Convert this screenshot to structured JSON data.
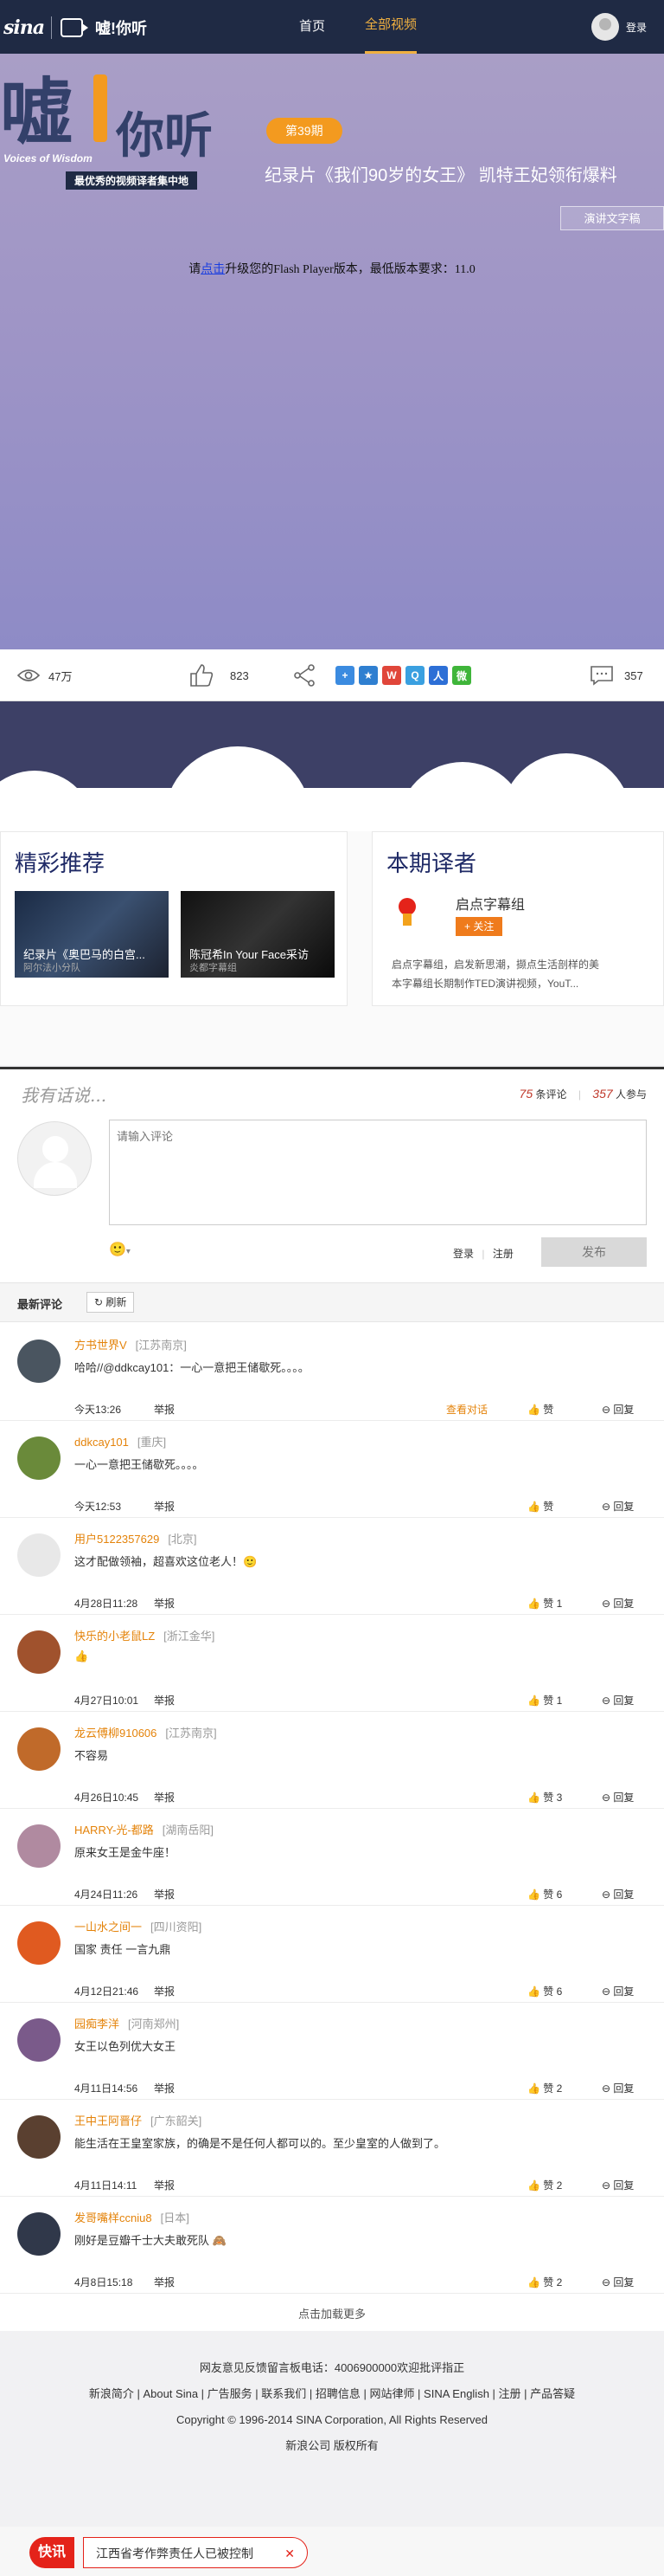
{
  "nav": {
    "logo_text": "sina",
    "subtitle": "嘘!你听",
    "links": [
      "首页",
      "全部视频"
    ],
    "login": "登录"
  },
  "hero": {
    "brand_big": "嘘",
    "brand_ting": "你听",
    "brand_en": "Voices of Wisdom",
    "brand_tagline": "最优秀的视频译者集中地",
    "issue": "第39期",
    "title": "纪录片《我们90岁的女王》 凯特王妃领衔爆料",
    "transcript_button": "演讲文字稿",
    "flash_before": "请",
    "flash_link": "点击",
    "flash_after": "升级您的Flash Player版本，最低版本要求：11.0"
  },
  "actions": {
    "views": "47万",
    "likes": "823",
    "comments": "357"
  },
  "recommend": {
    "heading": "精彩推荐",
    "items": [
      {
        "caption": "纪录片《奥巴马的白宫...",
        "sub": "阿尔法小分队"
      },
      {
        "caption": "陈冠希In Your Face采访",
        "sub": "炎都字幕组"
      }
    ]
  },
  "translator": {
    "heading": "本期译者",
    "name": "启点字幕组",
    "follow": "+ 关注",
    "desc_line1": "启点字幕组，启发新思潮，撷点生活剖样的美",
    "desc_line2": "本字幕组长期制作TED演讲视频，YouT..."
  },
  "comment_box": {
    "title": "我有话说...",
    "count_comments": "75",
    "count_comments_label": "条评论",
    "count_people": "357",
    "count_people_label": "人参与",
    "placeholder": "请输入评论",
    "login": "登录",
    "register": "注册",
    "publish": "发布",
    "latest": "最新评论",
    "refresh": "刷新"
  },
  "comments": [
    {
      "name": "方书世界V",
      "loc": "[江苏南京]",
      "text": "哈哈//@ddkcay101：一心一意把王储歇死。。。。",
      "time": "今天13:26",
      "like": "赞",
      "conversation": "查看对话",
      "avatar_color": "#4a5560"
    },
    {
      "name": "ddkcay101",
      "loc": "[重庆]",
      "text": "一心一意把王储歇死。。。。",
      "time": "今天12:53",
      "like": "赞",
      "avatar_color": "#6a8a3a"
    },
    {
      "name": "用户5122357629",
      "loc": "[北京]",
      "text": "这才配做领袖，超喜欢这位老人！🙂",
      "time": "4月28日11:28",
      "like": "赞 1",
      "avatar_color": "#e8e8e8"
    },
    {
      "name": "快乐的小老鼠LZ",
      "loc": "[浙江金华]",
      "text": "👍",
      "time": "4月27日10:01",
      "like": "赞 1",
      "avatar_color": "#a0522d"
    },
    {
      "name": "龙云傅柳910606",
      "loc": "[江苏南京]",
      "text": "不容易",
      "time": "4月26日10:45",
      "like": "赞 3",
      "avatar_color": "#c06a2a"
    },
    {
      "name": "HARRY-光-都路",
      "loc": "[湖南岳阳]",
      "text": "原来女王是金牛座！",
      "time": "4月24日11:26",
      "like": "赞 6",
      "avatar_color": "#b08aa0"
    },
    {
      "name": "一山水之间一",
      "loc": "[四川资阳]",
      "text": "国家  责任  一言九鼎",
      "time": "4月12日21:46",
      "like": "赞 6",
      "avatar_color": "#e05a20"
    },
    {
      "name": "园痴李洋",
      "loc": "[河南郑州]",
      "text": "女王以色列优大女王",
      "time": "4月11日14:56",
      "like": "赞 2",
      "avatar_color": "#7a5a8a"
    },
    {
      "name": "王中王阿晋仔",
      "loc": "[广东韶关]",
      "text": "能生活在王皇室家族，的确是不是任何人都可以的。至少皇室的人做到了。",
      "time": "4月11日14:11",
      "like": "赞 2",
      "avatar_color": "#5a4030"
    },
    {
      "name": "发哥嘴样ccniu8",
      "loc": "[日本]",
      "text": "刚好是豆瓣千士大夫敢死队 🙈",
      "time": "4月8日15:18",
      "like": "赞 2",
      "avatar_color": "#30384a"
    }
  ],
  "comment_common": {
    "report": "举报",
    "reply": "回复",
    "load_more": "点击加载更多"
  },
  "footer": {
    "line1": "网友意见反馈留言板电话：4006900000欢迎批评指正",
    "line2": "新浪简介 | About Sina | 广告服务 | 联系我们 | 招聘信息 | 网站律师 | SINA English | 注册 | 产品答疑",
    "line3": "Copyright © 1996-2014 SINA Corporation, All Rights Reserved",
    "line4": "新浪公司 版权所有"
  },
  "newsbar": {
    "badge": "快讯",
    "text": "江西省考作弊责任人已被控制",
    "close": "✕"
  }
}
